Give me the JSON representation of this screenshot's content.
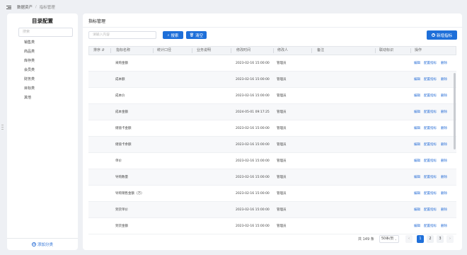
{
  "breadcrumb": {
    "items": [
      "数据资产",
      "指标管理"
    ]
  },
  "sidebar": {
    "title": "目录配置",
    "search_placeholder": "搜索",
    "categories": [
      "销售类",
      "商品类",
      "库存类",
      "会员类",
      "财务类",
      "目标类",
      "其他"
    ],
    "add_label": "添加分类"
  },
  "main": {
    "title": "指标管理",
    "search_placeholder": "请输入内容",
    "search_label": "搜索",
    "clear_label": "清空",
    "add_label": "新增指标",
    "columns": [
      "排序",
      "指标名称",
      "统计口径",
      "业务说明",
      "修改时间",
      "修改人",
      "备注",
      "联动标识",
      "操作"
    ],
    "rows": [
      {
        "name": "采购金额",
        "time": "2023-02-16 15:00:00",
        "user": "管理员"
      },
      {
        "name": "成本额",
        "time": "2023-02-16 15:00:00",
        "user": "管理员"
      },
      {
        "name": "成本价",
        "time": "2023-02-16 15:00:00",
        "user": "管理员"
      },
      {
        "name": "成本金额",
        "time": "2024-05-01 09:17:25",
        "user": "管理员"
      },
      {
        "name": "储值卡金额",
        "time": "2023-02-16 15:00:00",
        "user": "管理员"
      },
      {
        "name": "储值卡余额",
        "time": "2023-02-16 15:00:00",
        "user": "管理员"
      },
      {
        "name": "单价",
        "time": "2023-02-16 15:00:00",
        "user": "管理员"
      },
      {
        "name": "导购数量",
        "time": "2023-02-16 15:00:00",
        "user": "管理员"
      },
      {
        "name": "导购销售金额（万）",
        "time": "2023-02-16 15:00:00",
        "user": "管理员"
      },
      {
        "name": "到货单价",
        "time": "2023-02-16 15:00:00",
        "user": "管理员"
      },
      {
        "name": "到货金额",
        "time": "2023-02-16 15:00:00",
        "user": "管理员"
      }
    ],
    "actions": {
      "edit": "编辑",
      "config": "配置指标",
      "delete": "删除"
    }
  },
  "pagination": {
    "total": "共 149 条",
    "page_size": "50条/页",
    "pages": [
      "1",
      "2",
      "3"
    ],
    "current": "1",
    "prev": "‹",
    "next": "›"
  }
}
